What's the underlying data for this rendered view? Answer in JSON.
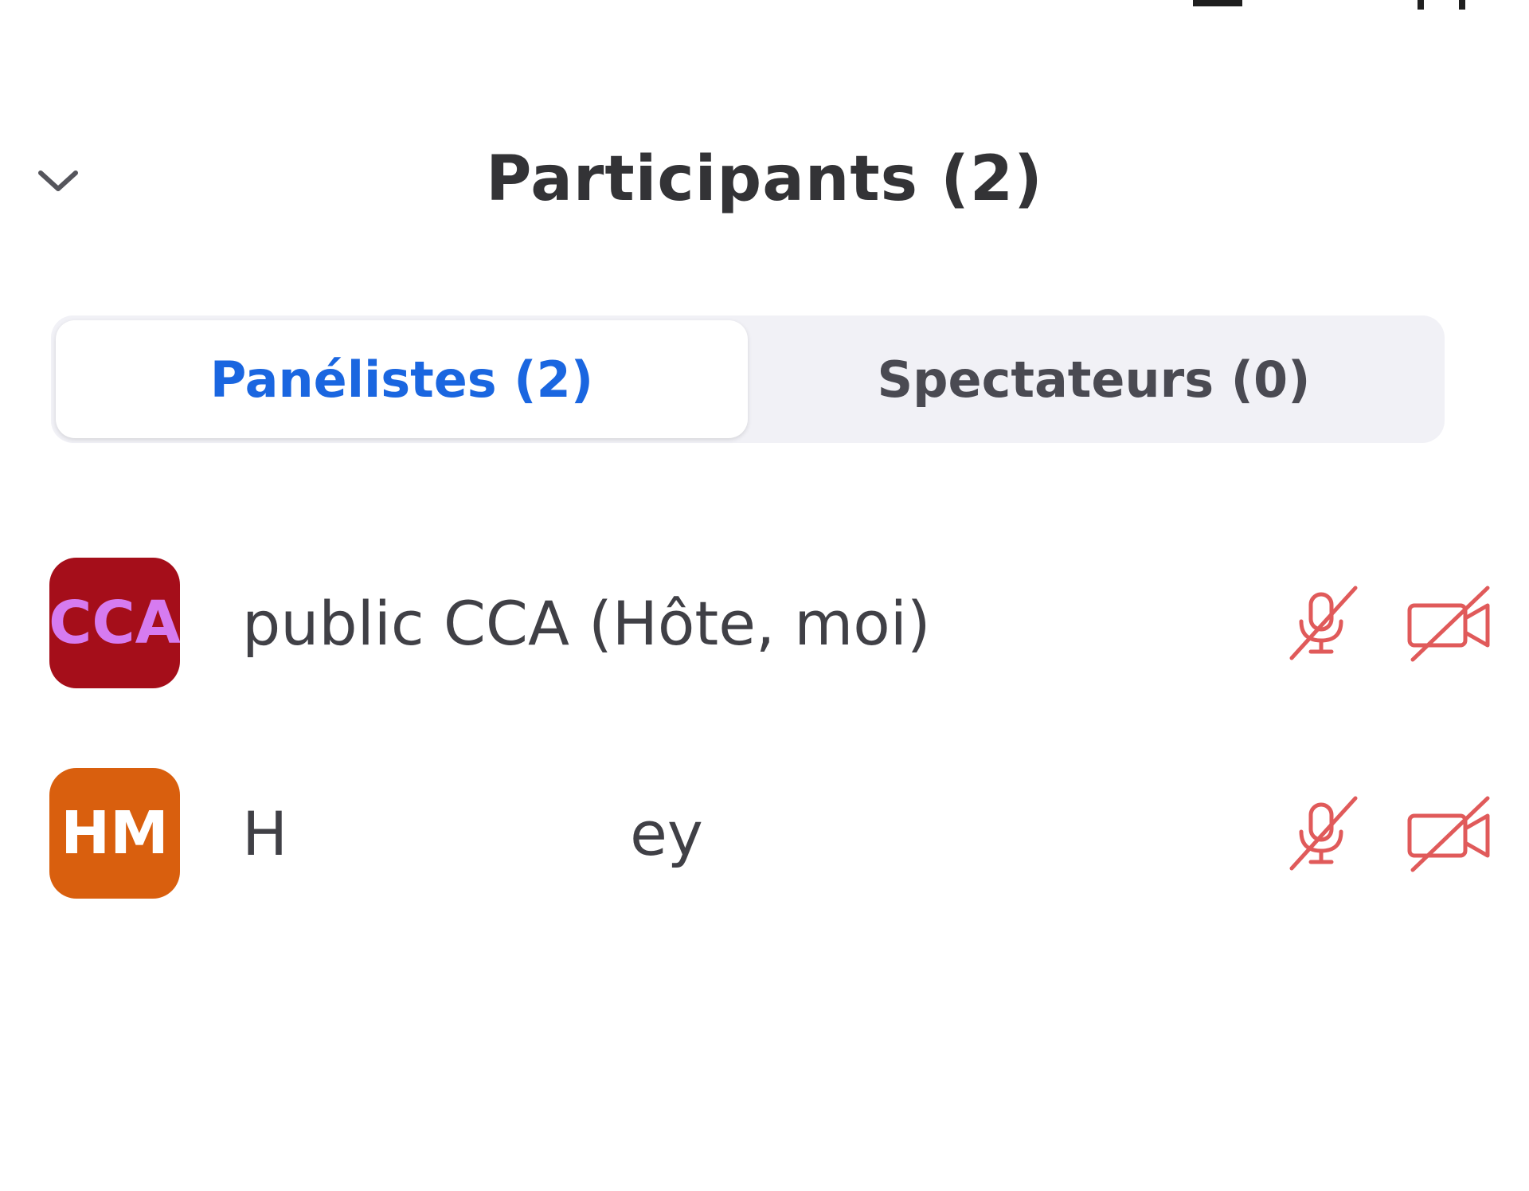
{
  "header": {
    "title": "Participants (2)",
    "collapse_icon": "chevron-down-icon"
  },
  "tabs": [
    {
      "label": "Panélistes (2)",
      "active": true
    },
    {
      "label": "Spectateurs (0)",
      "active": false
    }
  ],
  "participants": [
    {
      "initials": "CCA",
      "name": "public CCA (Hôte, moi)",
      "avatar_bg": "#a50e1a",
      "avatar_fg": "#d67bf0",
      "mic_icon": "mic-muted-icon",
      "video_icon": "video-off-icon"
    },
    {
      "initials": "HM",
      "name_start": "H",
      "name_end": "ey",
      "avatar_bg": "#d95f0e",
      "avatar_fg": "#ffffff",
      "mic_icon": "mic-muted-icon",
      "video_icon": "video-off-icon"
    }
  ],
  "colors": {
    "accent": "#1a66e0",
    "muted_red": "#e05a5a",
    "tab_bg": "#f1f1f6"
  }
}
